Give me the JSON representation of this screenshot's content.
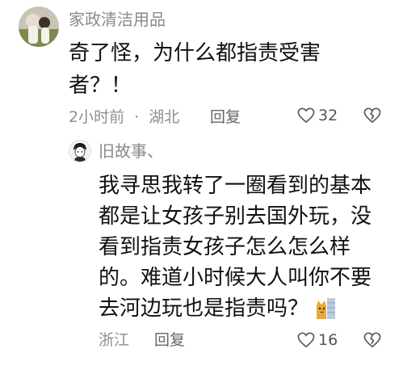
{
  "comments": [
    {
      "username": "家政清洁用品",
      "text_lines": [
        "奇了怪，为什么都指责受害",
        "者？！"
      ],
      "time": "2小时前",
      "sep": "·",
      "location": "湖北",
      "reply_label": "回复",
      "likes": "32"
    }
  ],
  "reply": {
    "username": "旧故事、",
    "text_lines": [
      "我寻思我转了一圈看到的基本",
      "都是让女孩子别去国外玩，没",
      "看到指责女孩子怎么怎么样",
      "的。难道小时候大人叫你不要",
      "去河边玩也是指责吗？"
    ],
    "emoji": "cat-thinking-sticker",
    "location": "浙江",
    "reply_label": "回复",
    "likes": "16"
  },
  "icons": {
    "like": "heart-outline-icon",
    "dislike": "broken-heart-outline-icon"
  },
  "colors": {
    "name": "#8a8a8a",
    "meta": "#8f8f8f",
    "text": "#111111"
  }
}
